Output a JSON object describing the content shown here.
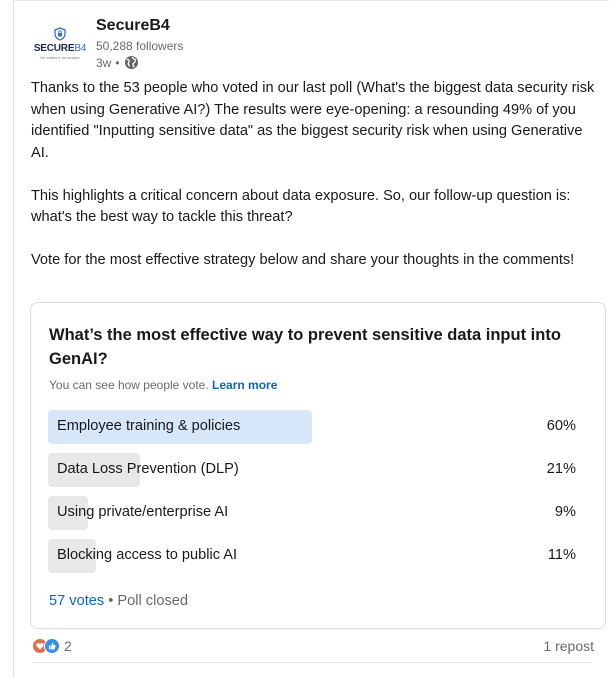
{
  "colors": {
    "link_blue": "#0a66c2",
    "leading_bar": "#d7e6f8",
    "bar": "#e8e8e8",
    "muted_text": "#666666"
  },
  "header": {
    "logo": {
      "wordmark": "SECURE",
      "wordmark_suffix": "B4",
      "tagline": "be resilient, be secure"
    },
    "company": "SecureB4",
    "followers": "50,288 followers",
    "time": "3w",
    "visibility_icon": "globe-icon"
  },
  "post": {
    "paragraphs": [
      "Thanks to the 53 people who voted in our last poll (What's the biggest data security risk when using Generative AI?) The results were eye-opening: a resounding 49% of you identified \"Inputting sensitive data\" as the biggest security risk when using Generative AI.",
      "This highlights a critical concern about data exposure. So, our follow-up question is: what's the best way to tackle this threat?",
      "Vote for the most effective strategy below and share your thoughts in the comments!"
    ]
  },
  "poll": {
    "question": "What’s the most effective way to prevent sensitive data input into GenAI?",
    "visibility_note": "You can see how people vote.",
    "learn_more": "Learn more",
    "options": [
      {
        "label": "Employee training & policies",
        "percent": 60,
        "percent_label": "60%"
      },
      {
        "label": "Data Loss Prevention (DLP)",
        "percent": 21,
        "percent_label": "21%"
      },
      {
        "label": "Using private/enterprise AI",
        "percent": 9,
        "percent_label": "9%"
      },
      {
        "label": "Blocking access to public AI",
        "percent": 11,
        "percent_label": "11%"
      }
    ],
    "votes": "57 votes",
    "status": "Poll closed"
  },
  "social": {
    "reaction_icons": [
      "heart-icon",
      "like-icon"
    ],
    "reaction_count": "2",
    "reposts": "1 repost"
  }
}
